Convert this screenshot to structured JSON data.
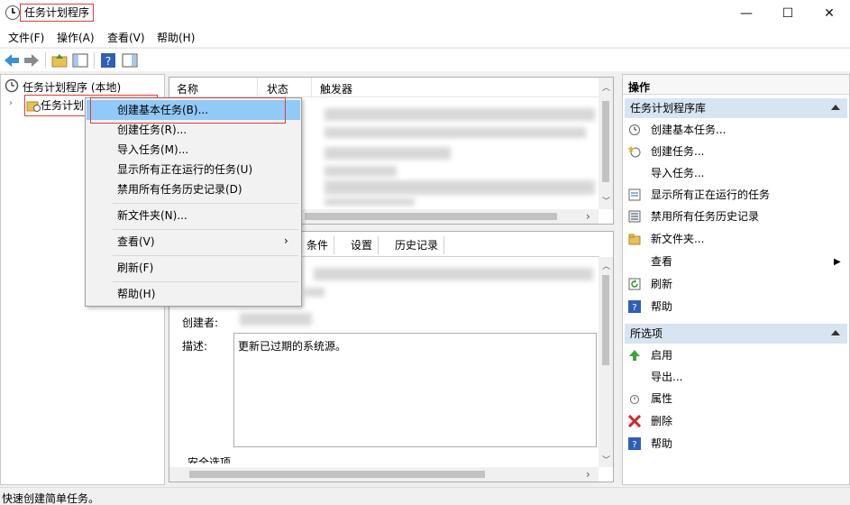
{
  "window": {
    "title": "任务计划程序",
    "minimize": "—",
    "maximize": "☐",
    "close": "✕"
  },
  "menubar": [
    "文件(F)",
    "操作(A)",
    "查看(V)",
    "帮助(H)"
  ],
  "tree": {
    "root": "任务计划程序 (本地)",
    "child": "任务计划"
  },
  "list": {
    "columns": [
      "名称",
      "状态",
      "触发器"
    ]
  },
  "tabs": [
    "条件",
    "设置",
    "历史记录"
  ],
  "details": {
    "creator_label": "创建者:",
    "description_label": "描述:",
    "description_value": "更新已过期的系统源。",
    "security_label": "安全选项"
  },
  "context_menu": [
    "创建基本任务(B)...",
    "创建任务(R)...",
    "导入任务(M)...",
    "显示所有正在运行的任务(U)",
    "禁用所有任务历史记录(D)",
    "新文件夹(N)...",
    "查看(V)",
    "刷新(F)",
    "帮助(H)"
  ],
  "actions": {
    "header": "操作",
    "section1_title": "任务计划程序库",
    "section1_items": [
      "创建基本任务...",
      "创建任务...",
      "导入任务...",
      "显示所有正在运行的任务",
      "禁用所有任务历史记录",
      "新文件夹...",
      "查看",
      "刷新",
      "帮助"
    ],
    "section2_title": "所选项",
    "section2_items": [
      "启用",
      "导出...",
      "属性",
      "删除",
      "帮助"
    ]
  },
  "status": "快速创建简单任务。",
  "colors": {
    "accent_border": "#e23b3b",
    "selection": "#91c9f7",
    "section_header": "#d7e4f2"
  }
}
